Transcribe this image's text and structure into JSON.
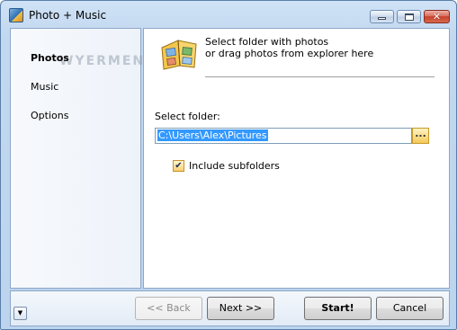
{
  "window": {
    "title": "Photo + Music"
  },
  "sidebar": {
    "watermark": "WYERMENT.COM",
    "items": [
      {
        "label": "Photos",
        "selected": true
      },
      {
        "label": "Music",
        "selected": false
      },
      {
        "label": "Options",
        "selected": false
      }
    ]
  },
  "content": {
    "header_line1": "Select folder with photos",
    "header_line2": "or drag photos from explorer here",
    "folder_label": "Select folder:",
    "folder_value": "C:\\Users\\Alex\\Pictures",
    "browse_label": "...",
    "include_subfolders_label": "Include subfolders",
    "include_subfolders_checked": true
  },
  "footer": {
    "back_label": "<< Back",
    "next_label": "Next >>",
    "start_label": "Start!",
    "cancel_label": "Cancel"
  },
  "icons": {
    "app": "photo-music-app-icon",
    "header": "photo-album-icon",
    "dropdown": "chevron-down-icon",
    "checkmark": "checkmark-icon"
  },
  "colors": {
    "selection": "#3399ff",
    "accent": "#f4c95a"
  }
}
